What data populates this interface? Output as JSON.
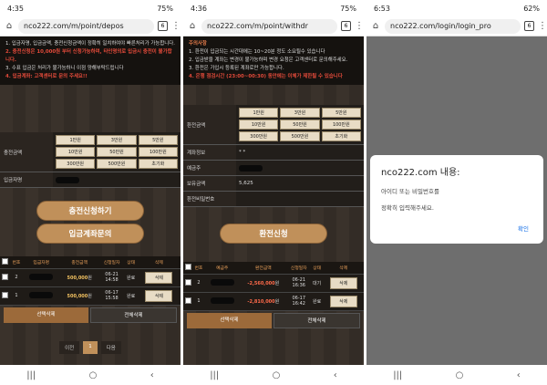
{
  "phones": [
    {
      "time": "4:35",
      "battery": "75%",
      "url": "nco222.com/m/point/depos"
    },
    {
      "time": "4:36",
      "battery": "75%",
      "url": "nco222.com/m/point/withdr"
    },
    {
      "time": "6:53",
      "battery": "62%",
      "url": "nco222.com/login/login_pro"
    }
  ],
  "tab_count": "6",
  "deposit": {
    "notice": [
      "1. 입금자명, 입금금액, 충전신청금액이 정확히 일치하여야 빠른처리가 가능합니다.",
      "2. 충전신청은 10,000원 부터 신청가능하며, 타인명의로 입금시 충전이 불가합니다.",
      "3. 수표 입금은 처리가 불가능하니 이점 양해부탁드립니다",
      "4. 입금계좌: 고객센터로 문의 주세요!!"
    ],
    "amount_label": "충전금액",
    "chips": [
      "1만원",
      "3만원",
      "5만원",
      "10만원",
      "50만원",
      "100만원",
      "300만원",
      "500만원",
      "초기화"
    ],
    "depositor_label": "입금자명",
    "submit": "충전신청하기",
    "account_inquiry": "입금계좌문의",
    "headers": [
      "번호",
      "입금자명",
      "충전금액",
      "신청일자",
      "상태",
      "삭제"
    ],
    "rows": [
      {
        "no": "2",
        "amount": "500,000",
        "unit": "원",
        "date": "06-21",
        "time": "14:58",
        "status": "완료",
        "del": "삭제"
      },
      {
        "no": "1",
        "amount": "500,000",
        "unit": "원",
        "date": "06-17",
        "time": "15:58",
        "status": "완료",
        "del": "삭제"
      }
    ],
    "sel_delete": "선택삭제",
    "all_delete": "전체삭제",
    "pager": {
      "prev": "이전",
      "page": "1",
      "next": "다음"
    }
  },
  "withdraw": {
    "notice_title": "주의사항",
    "notice": [
      "1. 환전이 입금되는 시간대에는 10~20분 정도 소요될수 있습니다",
      "2. 입금받을 계좌는 변경이 불가능하며 변경 요청은 고객센터로 문의해주세요.",
      "3. 환전은 가입시 등록된 계좌로만 가능합니다.",
      "4. 은행 점검시간 (23:00~00:30) 동안에는 이체가 제한될 수 있습니다"
    ],
    "amount_label": "환전금액",
    "chips": [
      "1만원",
      "3만원",
      "5만원",
      "10만원",
      "50만원",
      "100만원",
      "300만원",
      "500만원",
      "초기화"
    ],
    "account_label": "계좌정보",
    "account_value": "* *",
    "holder_label": "예금주",
    "balance_label": "보유금액",
    "balance_value": "5,625",
    "pw_label": "환전비밀번호",
    "submit": "환전신청",
    "headers": [
      "번호",
      "예금주",
      "환전금액",
      "신청일자",
      "상태",
      "삭제"
    ],
    "rows": [
      {
        "no": "2",
        "amount": "-2,560,000",
        "unit": "원",
        "date": "06-21",
        "time": "16:36",
        "status": "대기",
        "del": "삭제"
      },
      {
        "no": "1",
        "amount": "-2,810,000",
        "unit": "원",
        "date": "06-17",
        "time": "16:42",
        "status": "완료",
        "del": "삭제"
      }
    ],
    "sel_delete": "선택삭제",
    "all_delete": "전체삭제"
  },
  "dialog": {
    "title": "nco222.com 내용:",
    "line1": "아이디 또는 비밀번호를",
    "line2": "정확히 입력해주세요.",
    "ok": "확인"
  }
}
